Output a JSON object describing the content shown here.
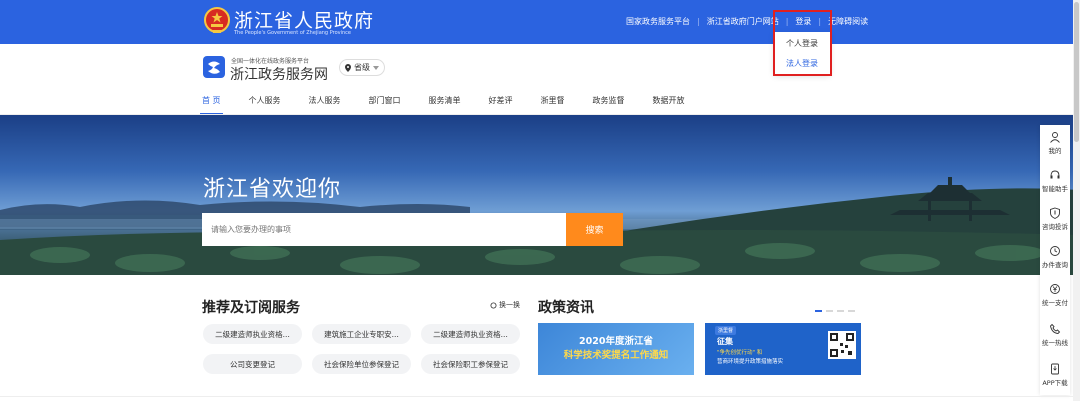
{
  "topbar": {
    "gov_title": "浙江省人民政府",
    "gov_subtitle": "The People's Government of Zhejiang Province",
    "links": [
      "国家政务服务平台",
      "浙江省政府门户网站",
      "登录",
      "无障碍阅读"
    ]
  },
  "login_dropdown": {
    "options": [
      "个人登录",
      "法人登录"
    ]
  },
  "service": {
    "tagline": "全国一体化在线政务服务平台",
    "name": "浙江政务服务网",
    "region": "省级"
  },
  "nav": [
    "首 页",
    "个人服务",
    "法人服务",
    "部门窗口",
    "服务清单",
    "好差评",
    "浙里督",
    "政务监督",
    "数据开放"
  ],
  "banner": {
    "welcome": "浙江省欢迎你",
    "search_placeholder": "请输入您要办理的事项",
    "search_button": "搜索"
  },
  "recommend": {
    "title": "推荐及订阅服务",
    "refresh": "换一换",
    "items": [
      "二级建造师执业资格...",
      "建筑施工企业专职安...",
      "二级建造师执业资格...",
      "公司变更登记",
      "社会保险单位参保登记",
      "社会保险职工参保登记"
    ]
  },
  "policy": {
    "title": "政策资讯",
    "card1": {
      "line1": "2020年度浙江省",
      "line2": "科学技术奖提名工作通知"
    },
    "card2": {
      "badge": "浙里督",
      "line1": "征集",
      "line2": "\"争先创优行动\" 和",
      "line3": "营商环境提升政策措施落实"
    }
  },
  "right_sidebar": [
    {
      "icon": "user-icon",
      "label": "我的"
    },
    {
      "icon": "headset-icon",
      "label": "智能助手"
    },
    {
      "icon": "shield-icon",
      "label": "咨询投诉"
    },
    {
      "icon": "clock-icon",
      "label": "办件查询"
    },
    {
      "icon": "yen-icon",
      "label": "统一支付"
    },
    {
      "icon": "phone-icon",
      "label": "统一热线"
    },
    {
      "icon": "download-icon",
      "label": "APP下载"
    }
  ],
  "colors": {
    "brand_blue": "#2b63e0",
    "accent_orange": "#ff8a1c",
    "highlight_red": "#e02020"
  }
}
